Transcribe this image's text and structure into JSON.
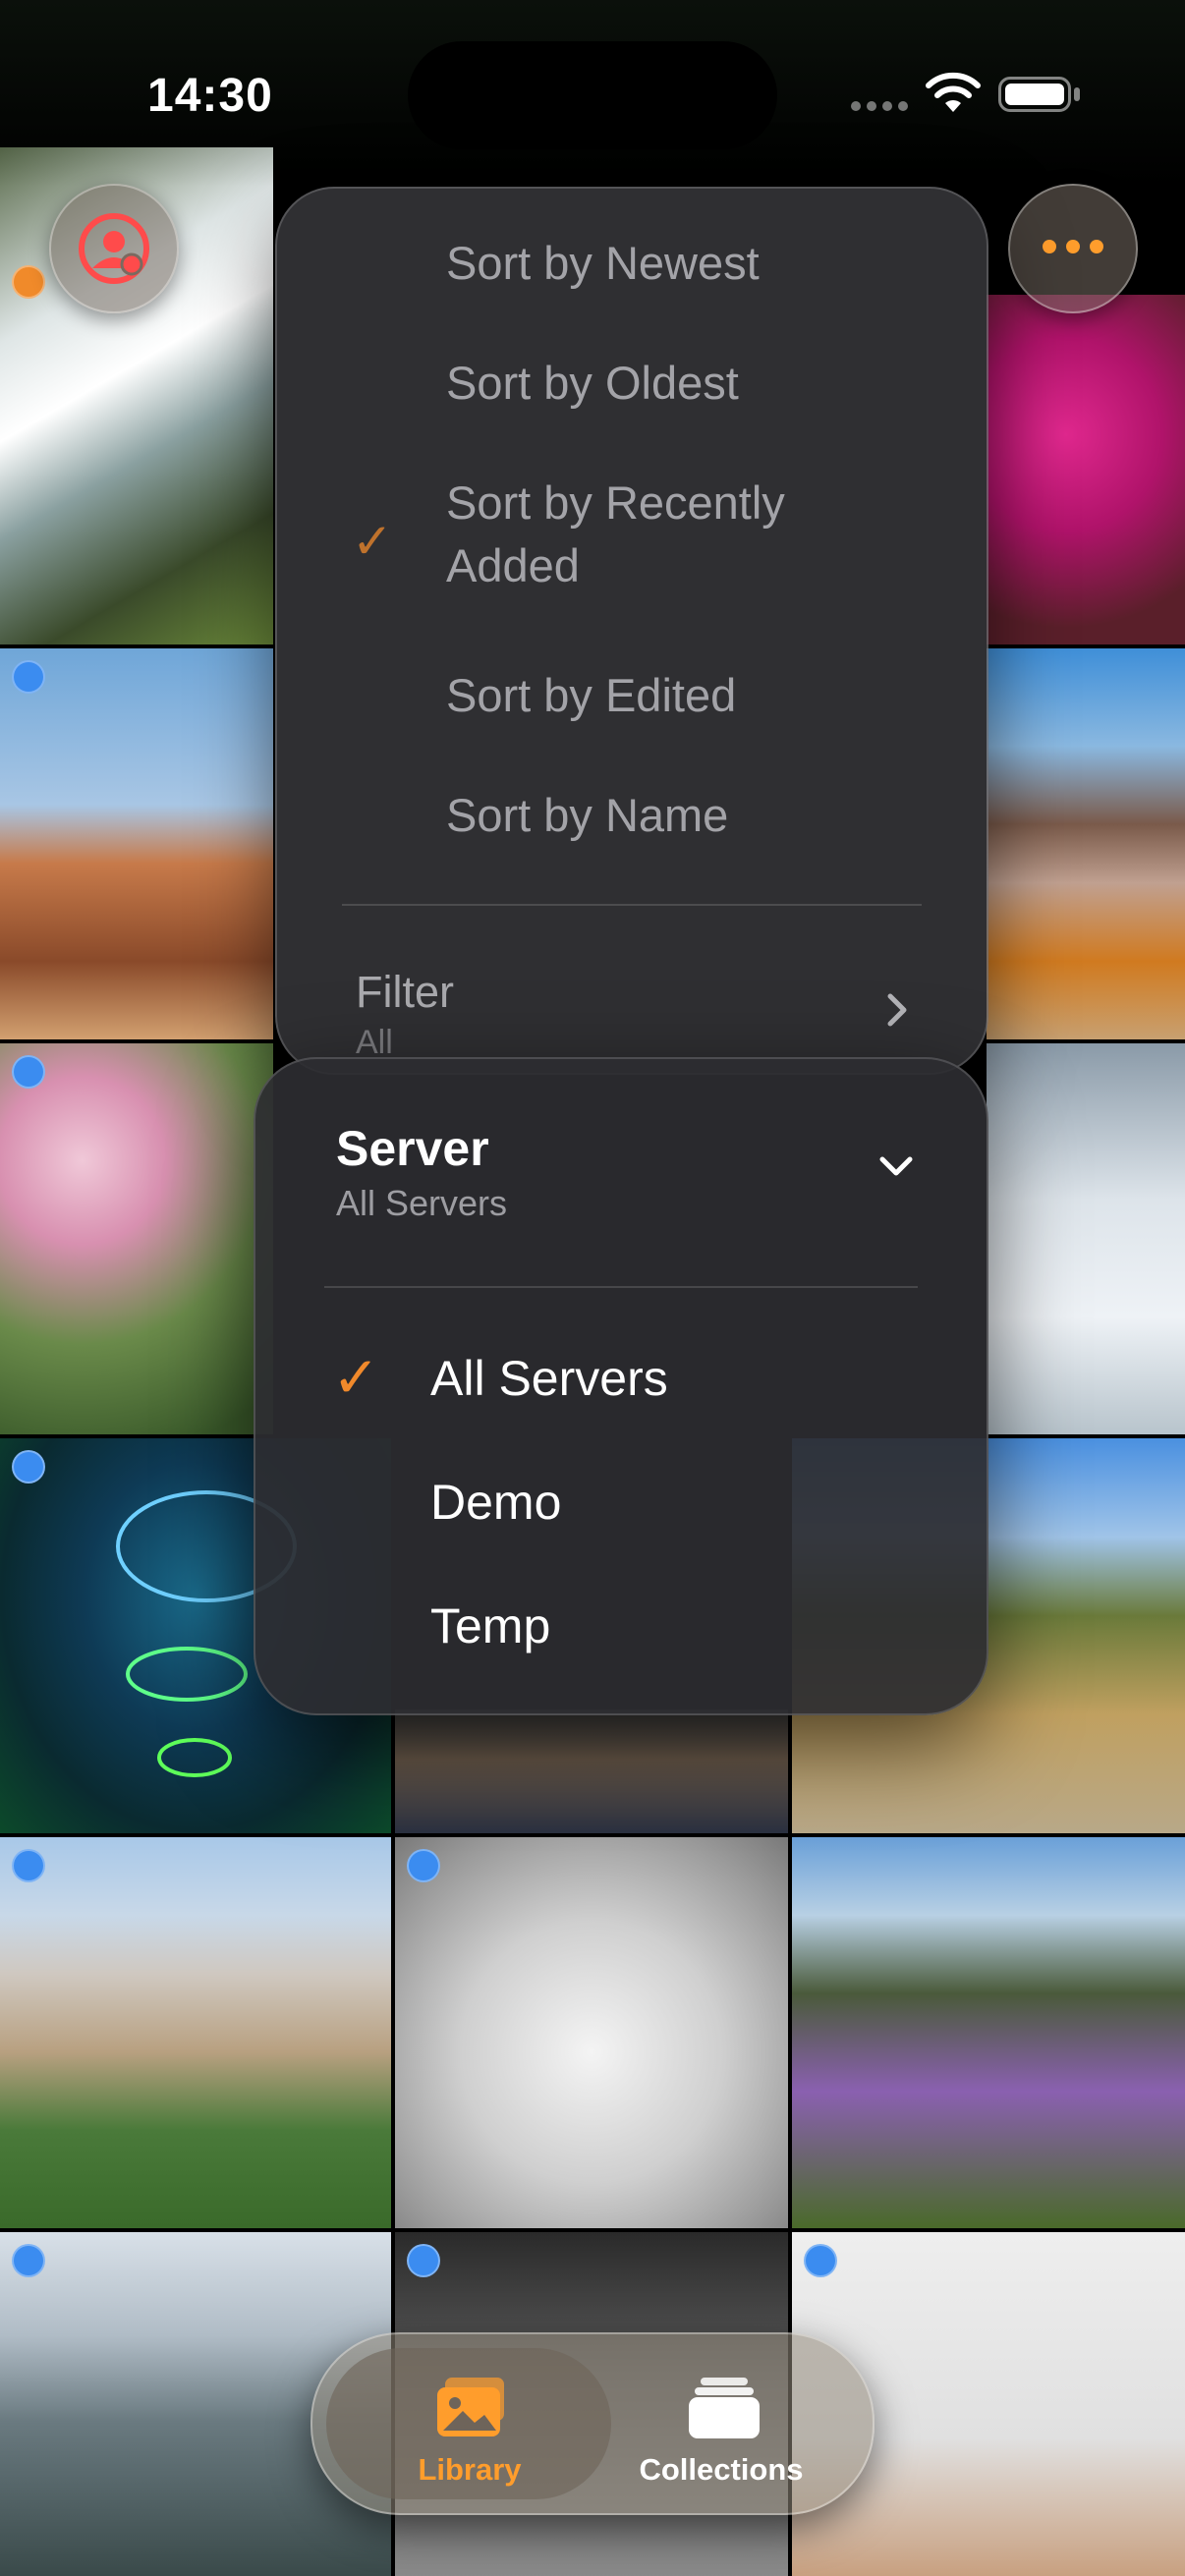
{
  "status_bar": {
    "time": "14:30"
  },
  "sort_menu": {
    "options": [
      {
        "label": "Sort by Newest",
        "selected": false
      },
      {
        "label": "Sort by Oldest",
        "selected": false
      },
      {
        "label": "Sort by Recently Added",
        "selected": true
      },
      {
        "label": "Sort by Edited",
        "selected": false
      },
      {
        "label": "Sort by Name",
        "selected": false
      }
    ],
    "filter": {
      "label": "Filter",
      "value": "All"
    }
  },
  "server_menu": {
    "title": "Server",
    "current": "All Servers",
    "options": [
      {
        "label": "All Servers",
        "selected": true
      },
      {
        "label": "Demo",
        "selected": false
      },
      {
        "label": "Temp",
        "selected": false
      }
    ]
  },
  "tab_bar": {
    "active": "Library",
    "tabs": [
      {
        "label": "Library"
      },
      {
        "label": "Collections"
      }
    ]
  },
  "colors": {
    "accent": "#ff9d2c",
    "selection_badge": "#3b8cf0",
    "profile_icon": "#ff4b4b"
  },
  "icons": {
    "profile": "person-circle-icon",
    "more": "ellipsis-icon",
    "library": "photo-stack-icon",
    "collections": "album-stack-icon"
  }
}
